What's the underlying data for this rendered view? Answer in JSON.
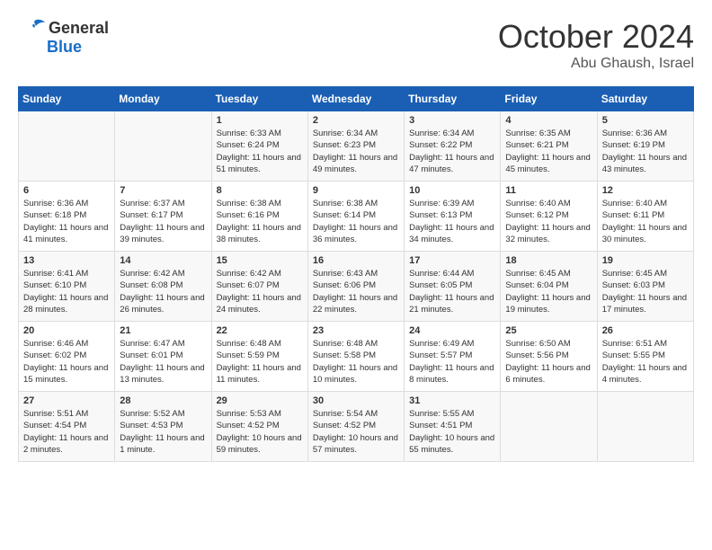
{
  "header": {
    "logo_general": "General",
    "logo_blue": "Blue",
    "month": "October 2024",
    "location": "Abu Ghaush, Israel"
  },
  "days_of_week": [
    "Sunday",
    "Monday",
    "Tuesday",
    "Wednesday",
    "Thursday",
    "Friday",
    "Saturday"
  ],
  "weeks": [
    [
      {
        "day": "",
        "text": ""
      },
      {
        "day": "",
        "text": ""
      },
      {
        "day": "1",
        "text": "Sunrise: 6:33 AM\nSunset: 6:24 PM\nDaylight: 11 hours and 51 minutes."
      },
      {
        "day": "2",
        "text": "Sunrise: 6:34 AM\nSunset: 6:23 PM\nDaylight: 11 hours and 49 minutes."
      },
      {
        "day": "3",
        "text": "Sunrise: 6:34 AM\nSunset: 6:22 PM\nDaylight: 11 hours and 47 minutes."
      },
      {
        "day": "4",
        "text": "Sunrise: 6:35 AM\nSunset: 6:21 PM\nDaylight: 11 hours and 45 minutes."
      },
      {
        "day": "5",
        "text": "Sunrise: 6:36 AM\nSunset: 6:19 PM\nDaylight: 11 hours and 43 minutes."
      }
    ],
    [
      {
        "day": "6",
        "text": "Sunrise: 6:36 AM\nSunset: 6:18 PM\nDaylight: 11 hours and 41 minutes."
      },
      {
        "day": "7",
        "text": "Sunrise: 6:37 AM\nSunset: 6:17 PM\nDaylight: 11 hours and 39 minutes."
      },
      {
        "day": "8",
        "text": "Sunrise: 6:38 AM\nSunset: 6:16 PM\nDaylight: 11 hours and 38 minutes."
      },
      {
        "day": "9",
        "text": "Sunrise: 6:38 AM\nSunset: 6:14 PM\nDaylight: 11 hours and 36 minutes."
      },
      {
        "day": "10",
        "text": "Sunrise: 6:39 AM\nSunset: 6:13 PM\nDaylight: 11 hours and 34 minutes."
      },
      {
        "day": "11",
        "text": "Sunrise: 6:40 AM\nSunset: 6:12 PM\nDaylight: 11 hours and 32 minutes."
      },
      {
        "day": "12",
        "text": "Sunrise: 6:40 AM\nSunset: 6:11 PM\nDaylight: 11 hours and 30 minutes."
      }
    ],
    [
      {
        "day": "13",
        "text": "Sunrise: 6:41 AM\nSunset: 6:10 PM\nDaylight: 11 hours and 28 minutes."
      },
      {
        "day": "14",
        "text": "Sunrise: 6:42 AM\nSunset: 6:08 PM\nDaylight: 11 hours and 26 minutes."
      },
      {
        "day": "15",
        "text": "Sunrise: 6:42 AM\nSunset: 6:07 PM\nDaylight: 11 hours and 24 minutes."
      },
      {
        "day": "16",
        "text": "Sunrise: 6:43 AM\nSunset: 6:06 PM\nDaylight: 11 hours and 22 minutes."
      },
      {
        "day": "17",
        "text": "Sunrise: 6:44 AM\nSunset: 6:05 PM\nDaylight: 11 hours and 21 minutes."
      },
      {
        "day": "18",
        "text": "Sunrise: 6:45 AM\nSunset: 6:04 PM\nDaylight: 11 hours and 19 minutes."
      },
      {
        "day": "19",
        "text": "Sunrise: 6:45 AM\nSunset: 6:03 PM\nDaylight: 11 hours and 17 minutes."
      }
    ],
    [
      {
        "day": "20",
        "text": "Sunrise: 6:46 AM\nSunset: 6:02 PM\nDaylight: 11 hours and 15 minutes."
      },
      {
        "day": "21",
        "text": "Sunrise: 6:47 AM\nSunset: 6:01 PM\nDaylight: 11 hours and 13 minutes."
      },
      {
        "day": "22",
        "text": "Sunrise: 6:48 AM\nSunset: 5:59 PM\nDaylight: 11 hours and 11 minutes."
      },
      {
        "day": "23",
        "text": "Sunrise: 6:48 AM\nSunset: 5:58 PM\nDaylight: 11 hours and 10 minutes."
      },
      {
        "day": "24",
        "text": "Sunrise: 6:49 AM\nSunset: 5:57 PM\nDaylight: 11 hours and 8 minutes."
      },
      {
        "day": "25",
        "text": "Sunrise: 6:50 AM\nSunset: 5:56 PM\nDaylight: 11 hours and 6 minutes."
      },
      {
        "day": "26",
        "text": "Sunrise: 6:51 AM\nSunset: 5:55 PM\nDaylight: 11 hours and 4 minutes."
      }
    ],
    [
      {
        "day": "27",
        "text": "Sunrise: 5:51 AM\nSunset: 4:54 PM\nDaylight: 11 hours and 2 minutes."
      },
      {
        "day": "28",
        "text": "Sunrise: 5:52 AM\nSunset: 4:53 PM\nDaylight: 11 hours and 1 minute."
      },
      {
        "day": "29",
        "text": "Sunrise: 5:53 AM\nSunset: 4:52 PM\nDaylight: 10 hours and 59 minutes."
      },
      {
        "day": "30",
        "text": "Sunrise: 5:54 AM\nSunset: 4:52 PM\nDaylight: 10 hours and 57 minutes."
      },
      {
        "day": "31",
        "text": "Sunrise: 5:55 AM\nSunset: 4:51 PM\nDaylight: 10 hours and 55 minutes."
      },
      {
        "day": "",
        "text": ""
      },
      {
        "day": "",
        "text": ""
      }
    ]
  ]
}
